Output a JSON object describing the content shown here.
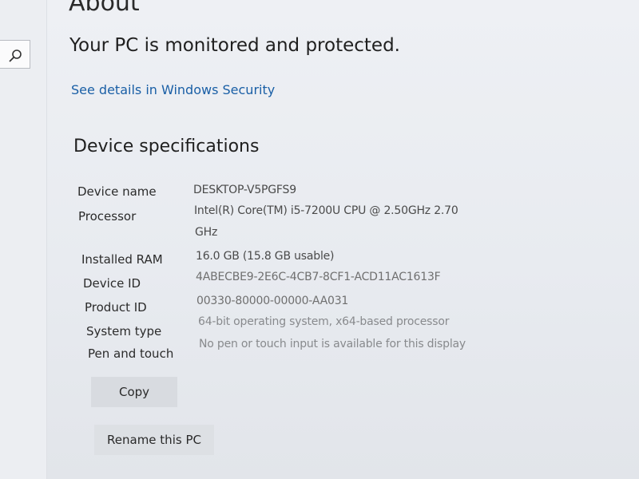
{
  "page": {
    "title": "About",
    "protection_status": "Your PC is monitored and protected.",
    "security_link": "See details in Windows Security"
  },
  "specs": {
    "heading": "Device specifications",
    "rows": [
      {
        "label": "Device name",
        "value": "DESKTOP-V5PGFS9"
      },
      {
        "label": "Processor",
        "value": "Intel(R) Core(TM) i5-7200U CPU @ 2.50GHz   2.70",
        "value2": "GHz"
      },
      {
        "label": "Installed RAM",
        "value": "16.0 GB (15.8 GB usable)"
      },
      {
        "label": "Device ID",
        "value": "4ABECBE9-2E6C-4CB7-8CF1-ACD11AC1613F"
      },
      {
        "label": "Product ID",
        "value": "00330-80000-00000-AA031"
      },
      {
        "label": "System type",
        "value": "64-bit operating system, x64-based processor"
      },
      {
        "label": "Pen and touch",
        "value": "No pen or touch input is available for this display"
      }
    ]
  },
  "buttons": {
    "copy": "Copy",
    "rename": "Rename this PC"
  },
  "sidebar": {
    "search_icon": "search-icon"
  }
}
